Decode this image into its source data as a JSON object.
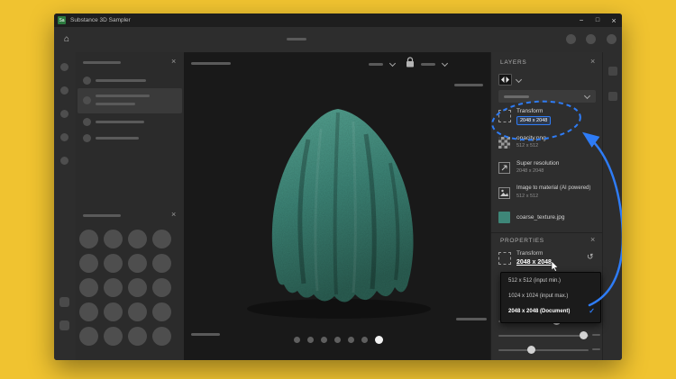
{
  "app": {
    "title": "Substance 3D Sampler",
    "logo_text": "Sa",
    "home_glyph": "⌂",
    "panel_close_glyph": "×",
    "window_controls": {
      "minimize": "−",
      "maximize": "□",
      "close": "×"
    }
  },
  "viewport": {
    "page_count": 7,
    "active_page": 7
  },
  "layers_panel": {
    "title": "LAYERS",
    "items": [
      {
        "name": "Transform",
        "badge": "2048 x 2048"
      },
      {
        "name": "opacity.png",
        "size": "512 x 512"
      },
      {
        "name": "Super resolution",
        "size": "2048 x 2048"
      },
      {
        "name": "Image to material (AI powered)",
        "size": "512 x 512"
      },
      {
        "name": "coarse_texture.jpg"
      }
    ]
  },
  "properties_panel": {
    "title": "PROPERTIES",
    "label": "Transform",
    "value": "2048 x 2048",
    "reset_glyph": "↺",
    "check_glyph": "✓",
    "options": [
      "512 x 512 (input min.)",
      "1024 x 1024 (input max.)",
      "2048 x 2048 (Document)"
    ]
  },
  "colors": {
    "background": "#F0C330",
    "accent_blue": "#2E7CF6",
    "material_teal": "#3E8678"
  }
}
